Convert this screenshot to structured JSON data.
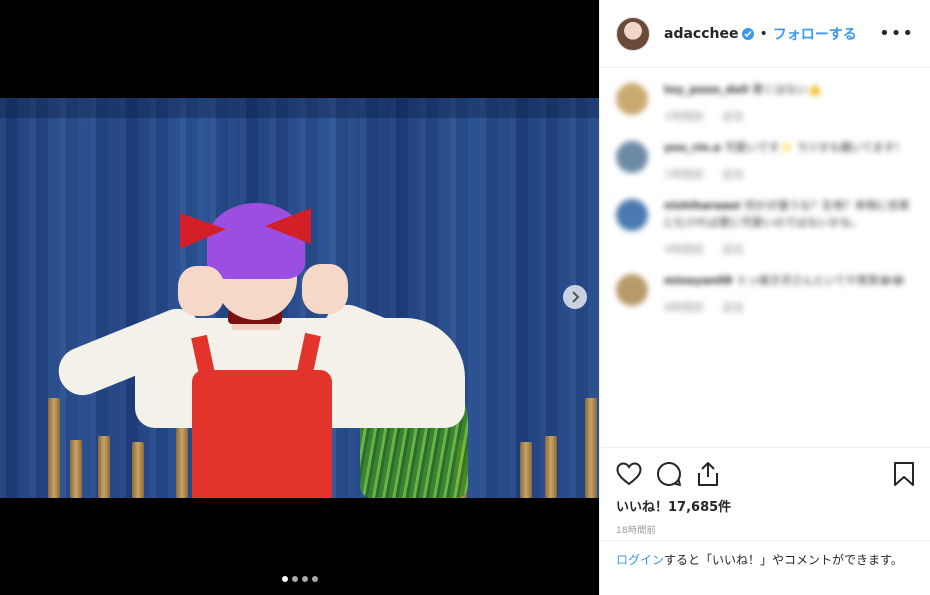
{
  "post": {
    "username": "adacchee",
    "follow_label": "フォローする",
    "separator": "•",
    "more_label": "•••"
  },
  "comments": [
    {
      "user": "toy_pooo_doll",
      "text": "悪くはない👍",
      "time": "1時間前",
      "reply": "返信"
    },
    {
      "user": "you_rin.a",
      "text": "可愛いです✨ ラジオも聞いてます！",
      "time": "1時間前",
      "reply": "返信"
    },
    {
      "user": "nishiharaaoi",
      "text": "何かが違うな？生地？本物に忠実にむければ更に可愛いのではないかな。",
      "time": "4時間前",
      "reply": "返信"
    },
    {
      "user": "mineyan08",
      "text": "ミッ嘘き沢さんといてや笑笑😂😂",
      "time": "8時間前",
      "reply": "返信"
    }
  ],
  "likes": "いいね！17,685件",
  "timestamp": "18時間前",
  "login": {
    "link": "ログイン",
    "text": "すると「いいね！」やコメントができます。"
  },
  "carousel": {
    "total": 4,
    "active": 0
  },
  "colors": {
    "link_blue": "#3897f0",
    "verified_blue": "#3897f0"
  }
}
